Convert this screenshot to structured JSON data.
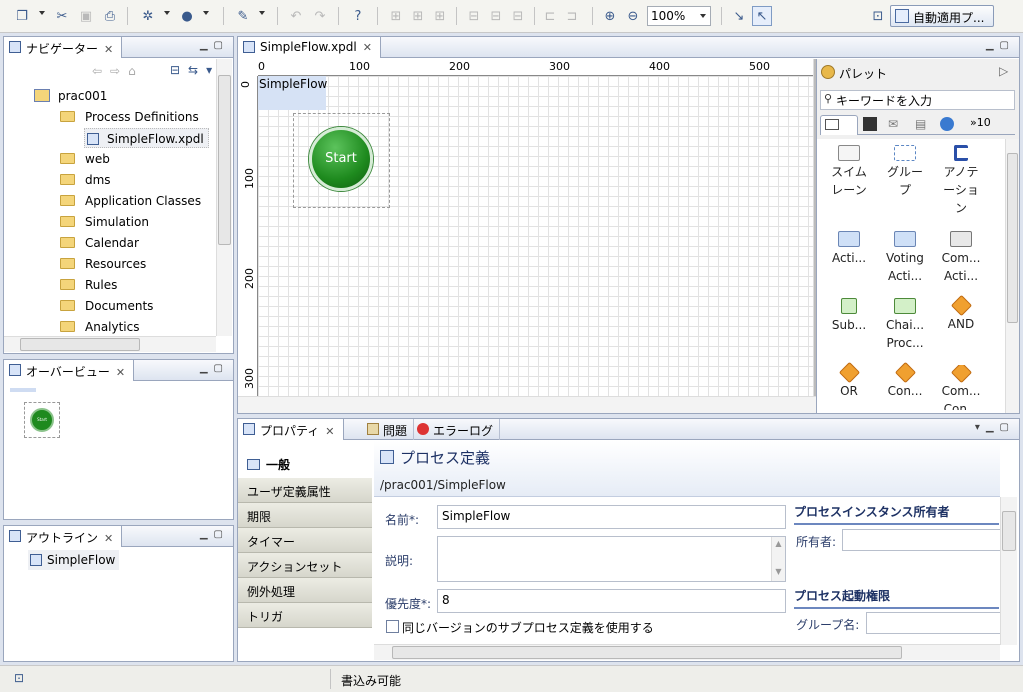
{
  "toolbar": {
    "zoom_value": "100%",
    "perspective_label": "自動適用プ..."
  },
  "navigator": {
    "title": "ナビゲーター",
    "project": "prac001",
    "items": [
      {
        "label": "Process Definitions"
      },
      {
        "label": "SimpleFlow.xpdl"
      },
      {
        "label": "web"
      },
      {
        "label": "dms"
      },
      {
        "label": "Application Classes"
      },
      {
        "label": "Simulation"
      },
      {
        "label": "Calendar"
      },
      {
        "label": "Resources"
      },
      {
        "label": "Rules"
      },
      {
        "label": "Documents"
      },
      {
        "label": "Analytics"
      }
    ]
  },
  "overview": {
    "title": "オーバービュー",
    "start_label": "Start"
  },
  "outline": {
    "title": "アウトライン",
    "item": "SimpleFlow"
  },
  "editor": {
    "tab_label": "SimpleFlow.xpdl",
    "pool_label": "SimpleFlow",
    "start_label": "Start",
    "ruler_h": [
      "0",
      "100",
      "200",
      "300",
      "400",
      "500"
    ],
    "ruler_v": [
      "0",
      "100",
      "200",
      "300"
    ]
  },
  "palette": {
    "title": "パレット",
    "search_placeholder": "キーワードを入力",
    "tab_count": "10",
    "items": [
      {
        "label": "スイム\nレーン",
        "icon": "swimlane-icon"
      },
      {
        "label": "グルー\nプ",
        "icon": "group-icon"
      },
      {
        "label": "アノテ\nーショ\nン",
        "icon": "annotation-icon"
      },
      {
        "label": "Acti...",
        "icon": "activity-icon"
      },
      {
        "label": "Voting\nActi...",
        "icon": "voting-activity-icon"
      },
      {
        "label": "Com...\nActi...",
        "icon": "compound-activity-icon"
      },
      {
        "label": "Sub...",
        "icon": "subprocess-icon"
      },
      {
        "label": "Chai...\nProc...",
        "icon": "chained-process-icon"
      },
      {
        "label": "AND",
        "icon": "and-gateway-icon"
      },
      {
        "label": "OR",
        "icon": "or-gateway-icon"
      },
      {
        "label": "Con...",
        "icon": "conditional-gateway-icon"
      },
      {
        "label": "Com...\nCon...",
        "icon": "complex-gateway-icon"
      }
    ]
  },
  "properties": {
    "tabs": [
      "プロパティ",
      "問題",
      "エラーログ"
    ],
    "categories": [
      "一般",
      "ユーザ定義属性",
      "期限",
      "タイマー",
      "アクションセット",
      "例外処理",
      "トリガ"
    ],
    "header_title": "プロセス定義",
    "header_path": "/prac001/SimpleFlow",
    "name_label": "名前*:",
    "name_value": "SimpleFlow",
    "desc_label": "説明:",
    "desc_value": "",
    "priority_label": "優先度*:",
    "priority_value": "8",
    "checkbox_label": "同じバージョンのサブプロセス定義を使用する",
    "owner_section": "プロセスインスタンス所有者",
    "owner_label": "所有者:",
    "owner_value": "",
    "permission_section": "プロセス起動権限",
    "group_label": "グループ名:",
    "group_value": ""
  },
  "status": {
    "text": "書込み可能"
  },
  "colors": {
    "start_node": "#1e8a1e",
    "accent": "#2f4f8f"
  }
}
